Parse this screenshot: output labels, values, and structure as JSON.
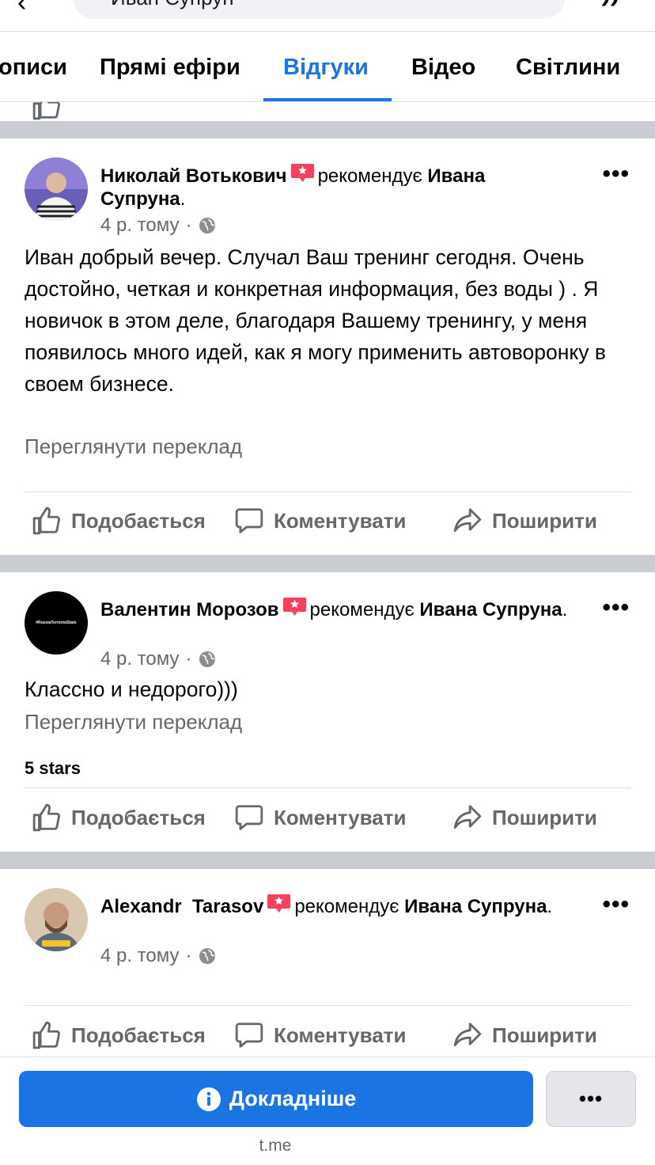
{
  "search": {
    "query": "Иван Супрун"
  },
  "tabs": [
    {
      "label": "описи"
    },
    {
      "label": "Прямі ефіри"
    },
    {
      "label": "Відгуки"
    },
    {
      "label": "Відео"
    },
    {
      "label": "Світлини"
    }
  ],
  "colors": {
    "accent": "#1b74e4",
    "secondary_text": "#65676b",
    "badge": "#f3425f",
    "separator": "#c9ccd1"
  },
  "reviews": [
    {
      "author": "Николай Вотькович",
      "verb": "рекомендує",
      "target": "Ивана Супруна",
      "time": "4 р. тому",
      "text": "Иван добрый вечер. Случал Ваш тренинг сегодня. Очень достойно, четкая и конкретная информация, без воды ) . Я новичок в этом деле, благодаря Вашему тренингу, у меня появилось много идей, как я могу применить автоворонку в своем бизнесе.",
      "translate": "Переглянути переклад",
      "stars": ""
    },
    {
      "author": "Валентин Морозов",
      "verb": "рекомендує",
      "target": "Ивана Супруна",
      "time": "4 р. тому",
      "text": "Классно и недорого)))",
      "translate": "Переглянути переклад",
      "stars": "5 stars",
      "avatar_text": "#RussiaTerroristState"
    },
    {
      "author": "Alexandr  Tarasov",
      "verb": "рекомендує",
      "target": "Ивана Супруна",
      "time": "4 р. тому",
      "text": "",
      "translate": "",
      "stars": ""
    }
  ],
  "actions": {
    "like": "Подобається",
    "comment": "Коментувати",
    "share": "Поширити"
  },
  "bottom": {
    "cta": "Докладніше",
    "more": "•••",
    "domain": "t.me"
  }
}
